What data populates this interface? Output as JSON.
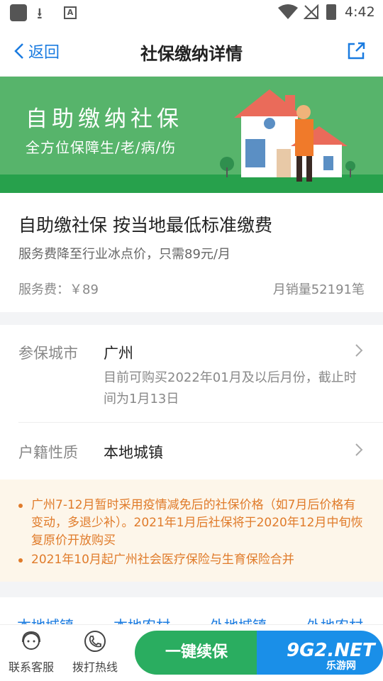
{
  "status_bar": {
    "time": "4:42"
  },
  "header": {
    "back_label": "返回",
    "title": "社保缴纳详情"
  },
  "banner": {
    "headline": "自助缴纳社保",
    "tagline": "全方位保障生/老/病/伤"
  },
  "product": {
    "title": "自助缴社保 按当地最低标准缴费",
    "subtitle": "服务费降至行业冰点价，只需89元/月",
    "fee": "服务费：￥89",
    "sales": "月销量52191笔"
  },
  "form": {
    "city_label": "参保城市",
    "city_value": "广州",
    "city_note": "目前可购买2022年01月及以后月份，截止时间为1月13日",
    "hukou_label": "户籍性质",
    "hukou_value": "本地城镇"
  },
  "notices": [
    "广州7-12月暂时采用疫情减免后的社保价格（如7月后价格有变动，多退少补）。2021年1月后社保将于2020年12月中旬恢复原价开放购买",
    "2021年10月起广州社会医疗保险与生育保险合并"
  ],
  "tabs": [
    "本地城镇",
    "本地农村",
    "外地城镇",
    "外地农村"
  ],
  "bottom_bar": {
    "service_label": "联系客服",
    "hotline_label": "拨打热线",
    "renew_label": "一键续保"
  },
  "watermark": {
    "brand": "9G2.NET",
    "sub": "乐游网"
  },
  "colors": {
    "accent_blue": "#1a7be0",
    "green": "#2aad60",
    "banner_green": "#57b46b",
    "notice_orange": "#e07b2a"
  }
}
